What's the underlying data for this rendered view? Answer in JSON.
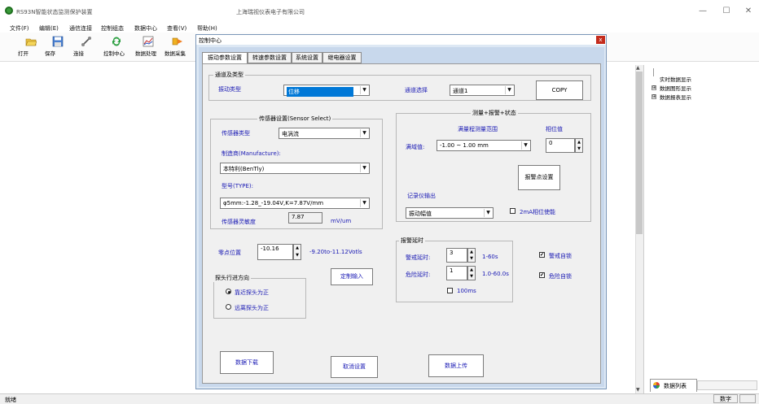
{
  "app": {
    "title": "RS93N智能状态监测保护装置",
    "company": "上海瑞视仪表电子有限公司",
    "window_controls": [
      "—",
      "☐",
      "✕"
    ]
  },
  "menu": [
    "文件(F)",
    "编辑(E)",
    "通信连接",
    "控制组态",
    "数据中心",
    "查看(V)",
    "帮助(H)"
  ],
  "toolbar": [
    {
      "label": "打开",
      "icon": "open-folder-icon"
    },
    {
      "label": "保存",
      "icon": "save-icon"
    },
    {
      "label": "连接",
      "icon": "connect-icon"
    },
    {
      "label": "控制中心",
      "icon": "control-center-icon"
    },
    {
      "label": "数据处理",
      "icon": "data-process-icon"
    },
    {
      "label": "数据采集",
      "icon": "data-acquire-icon"
    }
  ],
  "tree": {
    "items": [
      "实时数据显示",
      "数据图形显示",
      "数据报表显示"
    ],
    "expanders": [
      "",
      "⊞",
      "⊞"
    ]
  },
  "bottom_tab": {
    "label": "数据列表"
  },
  "status": {
    "ready": "就绪",
    "num": "数字"
  },
  "dialog": {
    "title": "控制中心",
    "close": "x",
    "tabs": [
      "振动参数设置",
      "转速参数设置",
      "系统设置",
      "继电器设置"
    ],
    "channel_group": {
      "title": "通道及类型",
      "vib_type_label": "振动类型",
      "vib_type_value": "位移",
      "channel_label": "通道选择",
      "channel_value": "通道1",
      "copy": "COPY"
    },
    "sensor_group": {
      "title": "传感器设置(Sensor Select)",
      "type_label": "传感器类型",
      "type_value": "电涡流",
      "maker_label": "制造商(Manufacture):",
      "maker_value": "本特利(BenTly)",
      "model_label": "型号(TYPE):",
      "model_value": "φ5mm:-1.28_-19.04V,K=7.87V/mm",
      "sens_label": "传感器灵敏度",
      "sens_value": "7.87",
      "sens_unit": "mV/um"
    },
    "measure_group": {
      "title": "测量+报警+状态",
      "range_title": "满量程测量范围",
      "phase_title": "相位值",
      "span_label": "满域值:",
      "span_value": "-1.00 ~ 1.00 mm",
      "phase_value": "0",
      "alarm_point": "报警点设置",
      "recorder_label": "记录仪输出",
      "recorder_value": "振动幅值",
      "phase_enable": "2mA相位使能"
    },
    "zero": {
      "label": "零点位置",
      "value": "-10.16",
      "range": "-9.20to-11.12Votls"
    },
    "custom_input": "定制输入",
    "direction_group": {
      "title": "探头行进方向",
      "near": "靠近探头为正",
      "far": "远离探头为正"
    },
    "delay_group": {
      "title": "报警延时",
      "warn_label": "警戒延时:",
      "warn_value": "3",
      "warn_range": "1-60s",
      "danger_label": "危险延时:",
      "danger_value": "1",
      "danger_range": "1.0-60.0s",
      "ms100": "100ms"
    },
    "warn_latch": "警戒自锁",
    "danger_latch": "危险自锁",
    "download": "数据下载",
    "cancel": "取消设置",
    "upload": "数据上传"
  }
}
